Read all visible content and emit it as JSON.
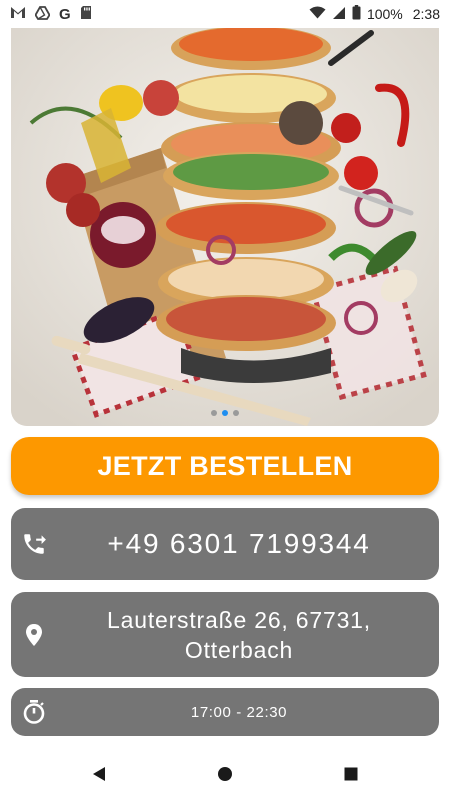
{
  "status_bar": {
    "notification_icons": [
      "gmail-icon",
      "drive-icon",
      "google-icon",
      "sd-card-icon"
    ],
    "battery": "100%",
    "time": "2:38"
  },
  "hero": {
    "image": "pizza-stack-illustration",
    "carousel_total": 3,
    "carousel_active_index": 1
  },
  "order_button": {
    "label": "JETZT BESTELLEN",
    "color": "#fd9800"
  },
  "contact": {
    "phone": "+49 6301 7199344",
    "address_line1": "Lauterstraße 26, 67731,",
    "address_line2": "Otterbach",
    "hours": "17:00 - 22:30",
    "card_color": "#757575"
  },
  "navigation": {
    "buttons": [
      "back",
      "home",
      "recents"
    ]
  }
}
